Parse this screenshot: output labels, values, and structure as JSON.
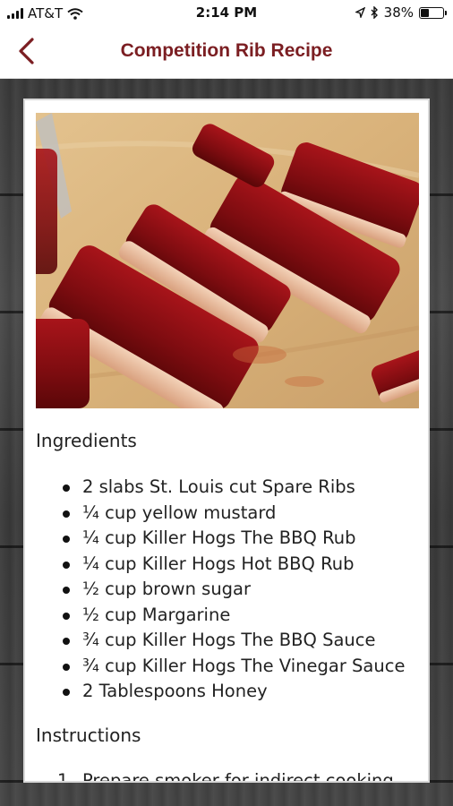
{
  "status_bar": {
    "carrier": "AT&T",
    "time": "2:14 PM",
    "battery_percent": "38%",
    "battery_level": 0.38,
    "icons": [
      "signal-bars-icon",
      "wifi-icon",
      "location-arrow-icon",
      "bluetooth-icon",
      "battery-icon"
    ]
  },
  "nav": {
    "title": "Competition Rib Recipe",
    "back_icon": "chevron-left-icon",
    "accent_color": "#7b1e22"
  },
  "recipe": {
    "image_alt": "rib-photo",
    "ingredients_heading": "Ingredients",
    "ingredients": [
      "2 slabs St. Louis cut Spare Ribs",
      "¼ cup yellow mustard",
      "¼ cup Killer Hogs The BBQ Rub",
      "¼ cup Killer Hogs Hot BBQ Rub",
      "½ cup brown sugar",
      "½ cup Margarine",
      "¾ cup Killer Hogs The BBQ Sauce",
      "¾ cup Killer Hogs The Vinegar Sauce",
      "2 Tablespoons Honey"
    ],
    "instructions_heading": "Instructions",
    "instructions": [
      {
        "num": "1.",
        "text": "Prepare smoker for indirect cooking"
      }
    ]
  }
}
